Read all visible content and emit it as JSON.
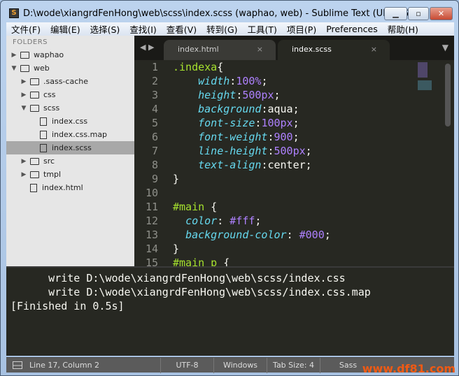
{
  "window": {
    "title": "D:\\wode\\xiangrdFenHong\\web\\scss\\index.scss (waphao, web) - Sublime Text (UNREGI...",
    "minimize": "▁",
    "maximize": "▫",
    "close": "✕"
  },
  "menu": [
    "文件(F)",
    "编辑(E)",
    "选择(S)",
    "查找(I)",
    "查看(V)",
    "转到(G)",
    "工具(T)",
    "项目(P)",
    "Preferences",
    "帮助(H)"
  ],
  "sidebar": {
    "header": "FOLDERS",
    "items": [
      {
        "label": "waphao",
        "type": "folder",
        "open": false,
        "depth": 0
      },
      {
        "label": "web",
        "type": "folder",
        "open": true,
        "depth": 0
      },
      {
        "label": ".sass-cache",
        "type": "folder",
        "open": false,
        "depth": 1
      },
      {
        "label": "css",
        "type": "folder",
        "open": false,
        "depth": 1
      },
      {
        "label": "scss",
        "type": "folder",
        "open": true,
        "depth": 1
      },
      {
        "label": "index.css",
        "type": "file",
        "depth": 2
      },
      {
        "label": "index.css.map",
        "type": "file",
        "depth": 2
      },
      {
        "label": "index.scss",
        "type": "file",
        "depth": 2,
        "selected": true
      },
      {
        "label": "src",
        "type": "folder",
        "open": false,
        "depth": 1
      },
      {
        "label": "tmpl",
        "type": "folder",
        "open": false,
        "depth": 1
      },
      {
        "label": "index.html",
        "type": "file",
        "depth": 1
      }
    ]
  },
  "tabs": [
    {
      "label": "index.html",
      "active": false
    },
    {
      "label": "index.scss",
      "active": true
    }
  ],
  "code": [
    [
      [
        "s",
        ".indexa"
      ],
      [
        "",
        "{"
      ]
    ],
    [
      [
        "",
        "    "
      ],
      [
        "p",
        "width"
      ],
      [
        "",
        ":"
      ],
      [
        "n",
        "100%"
      ],
      [
        "",
        ";"
      ]
    ],
    [
      [
        "",
        "    "
      ],
      [
        "p",
        "height"
      ],
      [
        "",
        ":"
      ],
      [
        "n",
        "500px"
      ],
      [
        "",
        ";"
      ]
    ],
    [
      [
        "",
        "    "
      ],
      [
        "p",
        "background"
      ],
      [
        "",
        ":aqua;"
      ]
    ],
    [
      [
        "",
        "    "
      ],
      [
        "p",
        "font-size"
      ],
      [
        "",
        ":"
      ],
      [
        "n",
        "100px"
      ],
      [
        "",
        ";"
      ]
    ],
    [
      [
        "",
        "    "
      ],
      [
        "p",
        "font-weight"
      ],
      [
        "",
        ":"
      ],
      [
        "n",
        "900"
      ],
      [
        "",
        ";"
      ]
    ],
    [
      [
        "",
        "    "
      ],
      [
        "p",
        "line-height"
      ],
      [
        "",
        ":"
      ],
      [
        "n",
        "500px"
      ],
      [
        "",
        ";"
      ]
    ],
    [
      [
        "",
        "    "
      ],
      [
        "p",
        "text-align"
      ],
      [
        "",
        ":center;"
      ]
    ],
    [
      [
        "",
        "}"
      ]
    ],
    [
      [
        "",
        ""
      ]
    ],
    [
      [
        "s",
        "#main"
      ],
      [
        "",
        " {"
      ]
    ],
    [
      [
        "",
        "  "
      ],
      [
        "p",
        "color"
      ],
      [
        "",
        ": "
      ],
      [
        "n",
        "#fff"
      ],
      [
        "",
        ";"
      ]
    ],
    [
      [
        "",
        "  "
      ],
      [
        "p",
        "background-color"
      ],
      [
        "",
        ": "
      ],
      [
        "n",
        "#000"
      ],
      [
        "",
        ";"
      ]
    ],
    [
      [
        "",
        "}"
      ]
    ],
    [
      [
        "s",
        "#main p"
      ],
      [
        "",
        " {"
      ]
    ]
  ],
  "console": [
    "      write D:\\wode\\xiangrdFenHong\\web\\scss/index.css",
    "      write D:\\wode\\xiangrdFenHong\\web\\scss/index.css.map",
    "[Finished in 0.5s]"
  ],
  "status": {
    "position": "Line 17, Column 2",
    "encoding": "UTF-8",
    "line_endings": "Windows",
    "tab_size": "Tab Size: 4",
    "syntax": "Sass"
  },
  "watermark": "www.df81.com"
}
